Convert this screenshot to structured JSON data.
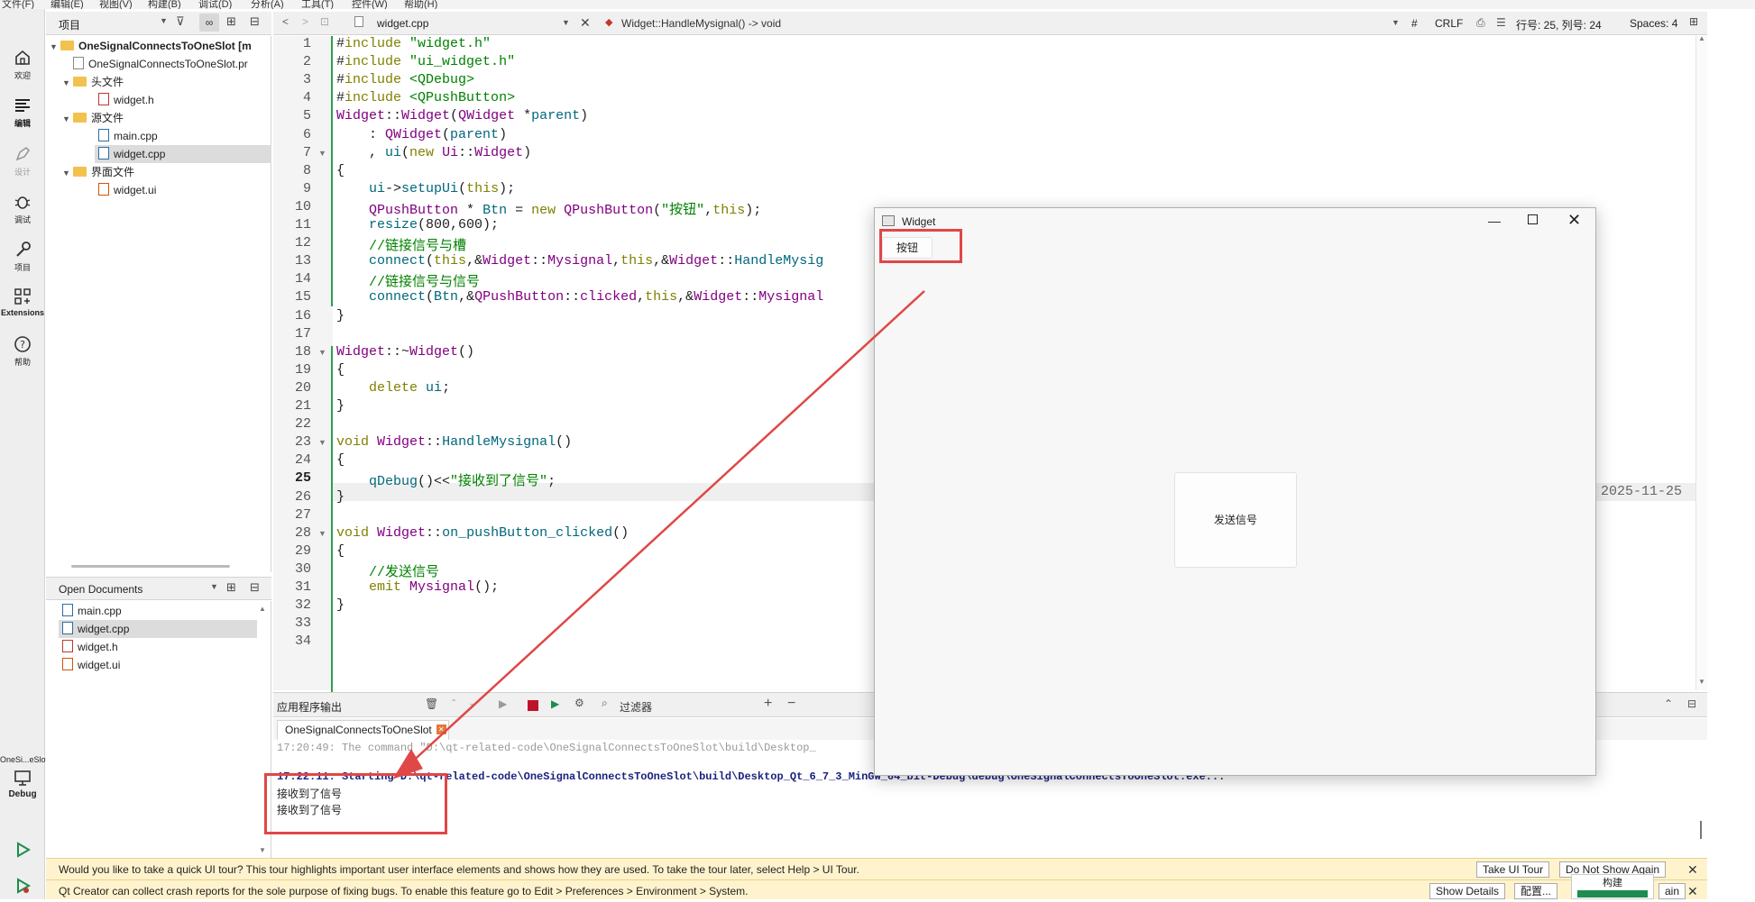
{
  "menu": [
    "文件(F)",
    "编辑(E)",
    "视图(V)",
    "构建(B)",
    "调试(D)",
    "分析(A)",
    "工具(T)",
    "控件(W)",
    "帮助(H)"
  ],
  "modes": [
    {
      "label": "欢迎",
      "icon": "home-icon"
    },
    {
      "label": "编辑",
      "icon": "edit-icon"
    },
    {
      "label": "设计",
      "icon": "design-icon"
    },
    {
      "label": "调试",
      "icon": "debug-icon"
    },
    {
      "label": "项目",
      "icon": "project-icon"
    },
    {
      "label": "Extensions",
      "icon": "extensions-icon"
    },
    {
      "label": "帮助",
      "icon": "help-icon"
    }
  ],
  "kit": {
    "name": "OneSi...eSlot",
    "mode": "Debug"
  },
  "project_panel": {
    "title": "项目",
    "items": [
      {
        "label": "OneSignalConnectsToOneSlot [m",
        "kind": "project"
      },
      {
        "label": "OneSignalConnectsToOneSlot.pr",
        "kind": "file"
      },
      {
        "label": "头文件",
        "kind": "folder"
      },
      {
        "label": "widget.h",
        "kind": "file"
      },
      {
        "label": "源文件",
        "kind": "folder"
      },
      {
        "label": "main.cpp",
        "kind": "file"
      },
      {
        "label": "widget.cpp",
        "kind": "file"
      },
      {
        "label": "界面文件",
        "kind": "folder"
      },
      {
        "label": "widget.ui",
        "kind": "file"
      }
    ]
  },
  "open_documents": {
    "title": "Open Documents",
    "items": [
      "main.cpp",
      "widget.cpp",
      "widget.h",
      "widget.ui"
    ]
  },
  "editor_toolbar": {
    "file": "widget.cpp",
    "symbol": "Widget::HandleMysignal() -> void",
    "hash": "#",
    "line_ending": "CRLF",
    "position": "行号: 25, 列号: 24",
    "spaces": "Spaces: 4"
  },
  "code_lines": [
    "#include \"widget.h\"",
    "#include \"ui_widget.h\"",
    "#include <QDebug>",
    "#include <QPushButton>",
    "Widget::Widget(QWidget *parent)",
    "    : QWidget(parent)",
    "    , ui(new Ui::Widget)",
    "{",
    "    ui->setupUi(this);",
    "    QPushButton * Btn = new QPushButton(\"按钮\",this);",
    "    resize(800,600);",
    "    //链接信号与槽",
    "    connect(this,&Widget::Mysignal,this,&Widget::HandleMysig",
    "    //链接信号与信号",
    "    connect(Btn,&QPushButton::clicked,this,&Widget::Mysignal",
    "}",
    "",
    "Widget::~Widget()",
    "{",
    "    delete ui;",
    "}",
    "",
    "void Widget::HandleMysignal()",
    "{",
    "    qDebug()<<\"接收到了信号\";",
    "}",
    "",
    "void Widget::on_pushButton_clicked()",
    "{",
    "    //发送信号",
    "    emit Mysignal();",
    "}",
    "",
    ""
  ],
  "current_line": 25,
  "blame_text": "2025-11-25",
  "output": {
    "title": "应用程序输出",
    "filter_placeholder": "过滤器",
    "tab": "OneSignalConnectsToOneSlot",
    "lines": [
      "17:20:49: The command \"D:\\qt-related-code\\OneSignalConnectsToOneSlot\\build\\Desktop_",
      "",
      "17:22:11: Starting D:\\qt-related-code\\OneSignalConnectsToOneSlot\\build\\Desktop_Qt_6_7_3_MinGW_64_bit-Debug\\debug\\OneSignalConnectsToOneSlot.exe...",
      "接收到了信号",
      "接收到了信号"
    ]
  },
  "notifications": [
    {
      "text": "Would you like to take a quick UI tour? This tour highlights important user interface elements and shows how they are used. To take the tour later, select Help > UI Tour.",
      "buttons": [
        "Take UI Tour",
        "Do Not Show Again"
      ]
    },
    {
      "text": "Qt Creator can collect crash reports for the sole purpose of fixing bugs. To enable this feature go to Edit > Preferences > Environment > System.",
      "buttons": [
        "Show Details",
        "配置...",
        "ain"
      ]
    }
  ],
  "build_label": "构建",
  "widget_window": {
    "title": "Widget",
    "small_button": "按钮",
    "big_button": "发送信号"
  },
  "colors": {
    "annotation": "#e04747",
    "accent": "#1e8c4e"
  }
}
